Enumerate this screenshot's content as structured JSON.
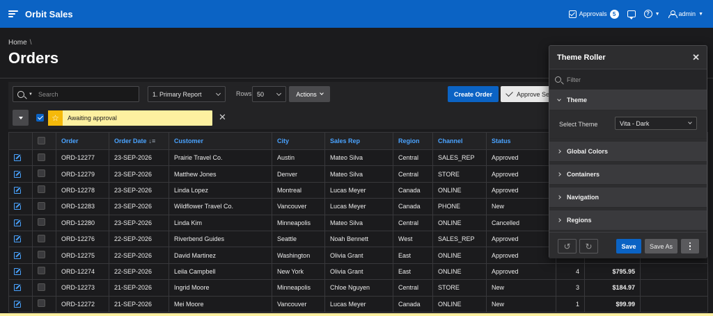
{
  "app": {
    "title": "Orbit Sales"
  },
  "nav": {
    "approvals_label": "Approvals",
    "approvals_count": "5",
    "user_name": "admin"
  },
  "breadcrumb": {
    "home": "Home",
    "separator": "\\"
  },
  "page": {
    "title": "Orders"
  },
  "toolbar": {
    "search_placeholder": "Search",
    "report_select": "1. Primary Report",
    "rows_label": "Rows",
    "rows_value": "50",
    "actions_label": "Actions",
    "create_label": "Create Order",
    "approve_label": "Approve Se"
  },
  "filter": {
    "label": "Awaiting approval"
  },
  "table": {
    "headers": [
      "Order",
      "Order Date",
      "Customer",
      "City",
      "Sales Rep",
      "Region",
      "Channel",
      "Status"
    ],
    "rows": [
      {
        "order": "ORD-12277",
        "date": "23-SEP-2026",
        "customer": "Prairie Travel Co.",
        "city": "Austin",
        "rep": "Mateo Silva",
        "region": "Central",
        "channel": "SALES_REP",
        "status": "Approved",
        "qty": "",
        "total": ""
      },
      {
        "order": "ORD-12279",
        "date": "23-SEP-2026",
        "customer": "Matthew Jones",
        "city": "Denver",
        "rep": "Mateo Silva",
        "region": "Central",
        "channel": "STORE",
        "status": "Approved",
        "qty": "",
        "total": ""
      },
      {
        "order": "ORD-12278",
        "date": "23-SEP-2026",
        "customer": "Linda Lopez",
        "city": "Montreal",
        "rep": "Lucas Meyer",
        "region": "Canada",
        "channel": "ONLINE",
        "status": "Approved",
        "qty": "",
        "total": ""
      },
      {
        "order": "ORD-12283",
        "date": "23-SEP-2026",
        "customer": "Wildflower Travel Co.",
        "city": "Vancouver",
        "rep": "Lucas Meyer",
        "region": "Canada",
        "channel": "PHONE",
        "status": "New",
        "qty": "",
        "total": ""
      },
      {
        "order": "ORD-12280",
        "date": "23-SEP-2026",
        "customer": "Linda Kim",
        "city": "Minneapolis",
        "rep": "Mateo Silva",
        "region": "Central",
        "channel": "ONLINE",
        "status": "Cancelled",
        "qty": "",
        "total": ""
      },
      {
        "order": "ORD-12276",
        "date": "22-SEP-2026",
        "customer": "Riverbend Guides",
        "city": "Seattle",
        "rep": "Noah Bennett",
        "region": "West",
        "channel": "SALES_REP",
        "status": "Approved",
        "qty": "",
        "total": ""
      },
      {
        "order": "ORD-12275",
        "date": "22-SEP-2026",
        "customer": "David Martinez",
        "city": "Washington",
        "rep": "Olivia Grant",
        "region": "East",
        "channel": "ONLINE",
        "status": "Approved",
        "qty": "",
        "total": ""
      },
      {
        "order": "ORD-12274",
        "date": "22-SEP-2026",
        "customer": "Leila Campbell",
        "city": "New York",
        "rep": "Olivia Grant",
        "region": "East",
        "channel": "ONLINE",
        "status": "Approved",
        "qty": "4",
        "total": "$795.95"
      },
      {
        "order": "ORD-12273",
        "date": "21-SEP-2026",
        "customer": "Ingrid Moore",
        "city": "Minneapolis",
        "rep": "Chloe Nguyen",
        "region": "Central",
        "channel": "STORE",
        "status": "New",
        "qty": "3",
        "total": "$184.97"
      },
      {
        "order": "ORD-12272",
        "date": "21-SEP-2026",
        "customer": "Mei Moore",
        "city": "Vancouver",
        "rep": "Lucas Meyer",
        "region": "Canada",
        "channel": "ONLINE",
        "status": "New",
        "qty": "1",
        "total": "$99.99"
      }
    ]
  },
  "theme_roller": {
    "title": "Theme Roller",
    "filter_placeholder": "Filter",
    "theme_section": "Theme",
    "select_theme_label": "Select Theme",
    "select_theme_value": "Vita - Dark",
    "sections": [
      "Global Colors",
      "Containers",
      "Navigation",
      "Regions"
    ],
    "save_label": "Save",
    "save_as_label": "Save As"
  },
  "colors": {
    "brand": "#0b63c4",
    "link": "#4aa3ff",
    "filter_highlight": "#fdf0a0",
    "star": "#f5b90a"
  }
}
